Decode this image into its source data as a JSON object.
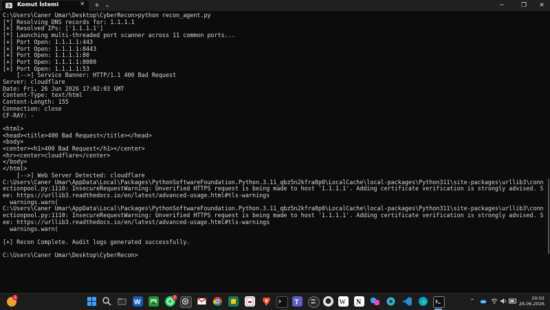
{
  "window": {
    "tab_title": "Komut İstemi",
    "tab_close": "×",
    "new_tab": "+",
    "tab_menu": "⌄",
    "minimize": "─",
    "maximize": "❐",
    "close": "✕"
  },
  "terminal": {
    "lines": [
      "C:\\Users\\Caner Umar\\Desktop\\CyberRecon>python recon_agent.py",
      "[*] Resolving DNS records for: 1.1.1.1",
      "[+] Resolved IPs: ['1.1.1.1']",
      "[*] Launching multi-threaded port scanner across 11 common ports...",
      "[+] Port Open: 1.1.1.1:443",
      "[+] Port Open: 1.1.1.1:8443",
      "[+] Port Open: 1.1.1.1:80",
      "[+] Port Open: 1.1.1.1:8080",
      "[+] Port Open: 1.1.1.1:53",
      "    [-->] Service Banner: HTTP/1.1 400 Bad Request",
      "Server: cloudflare",
      "Date: Fri, 26 Jun 2026 17:02:03 GMT",
      "Content-Type: text/html",
      "Content-Length: 155",
      "Connection: close",
      "CF-RAY: -",
      "",
      "<html>",
      "<head><title>400 Bad Request</title></head>",
      "<body>",
      "<center><h1>400 Bad Request</h1></center>",
      "<hr><center>cloudflare</center>",
      "</body>",
      "</html>",
      "    [-->] Web Server Detected: cloudflare",
      "C:\\Users\\Caner Umar\\AppData\\Local\\Packages\\PythonSoftwareFoundation.Python.3.11_qbz5n2kfra8p0\\LocalCache\\local-packages\\Python311\\site-packages\\urllib3\\conn",
      "ectionpool.py:1110: InsecureRequestWarning: Unverified HTTPS request is being made to host '1.1.1.1'. Adding certificate verification is strongly advised. S",
      "ee: https://urllib3.readthedocs.io/en/latest/advanced-usage.html#tls-warnings",
      "  warnings.warn(",
      "C:\\Users\\Caner Umar\\AppData\\Local\\Packages\\PythonSoftwareFoundation.Python.3.11_qbz5n2kfra8p0\\LocalCache\\local-packages\\Python311\\site-packages\\urllib3\\conn",
      "ectionpool.py:1110: InsecureRequestWarning: Unverified HTTPS request is being made to host '1.1.1.1'. Adding certificate verification is strongly advised. S",
      "ee: https://urllib3.readthedocs.io/en/latest/advanced-usage.html#tls-warnings",
      "  warnings.warn(",
      "",
      "[+] Recon Complete. Audit logs generated successfully.",
      "",
      "C:\\Users\\Caner Umar\\Desktop\\CyberRecon>"
    ]
  },
  "taskbar": {
    "weather_badge": "1",
    "whatsapp_badge": "2",
    "icons": [
      "start-icon",
      "search-icon",
      "file-explorer-icon",
      "word-icon",
      "photos-icon",
      "whatsapp-icon",
      "chatgpt-icon",
      "gmail-icon",
      "chrome-icon",
      "project-icon",
      "pdf-icon",
      "brave-icon",
      "terminal-dark-icon",
      "teams-icon",
      "capcut-icon",
      "github-icon",
      "wikipedia-icon",
      "notion-icon",
      "copilot-icon",
      "claude-icon",
      "vscode-icon",
      "edge-icon",
      "cmd-icon"
    ],
    "tray_chevron": "^",
    "time": "20:02",
    "date": "26.06.2026"
  },
  "colors": {
    "terminal_bg": "#0c0c0c",
    "terminal_text": "#d8d8d8",
    "taskbar_bg": "#1c1c1c",
    "accent": "#4cc2ff"
  }
}
